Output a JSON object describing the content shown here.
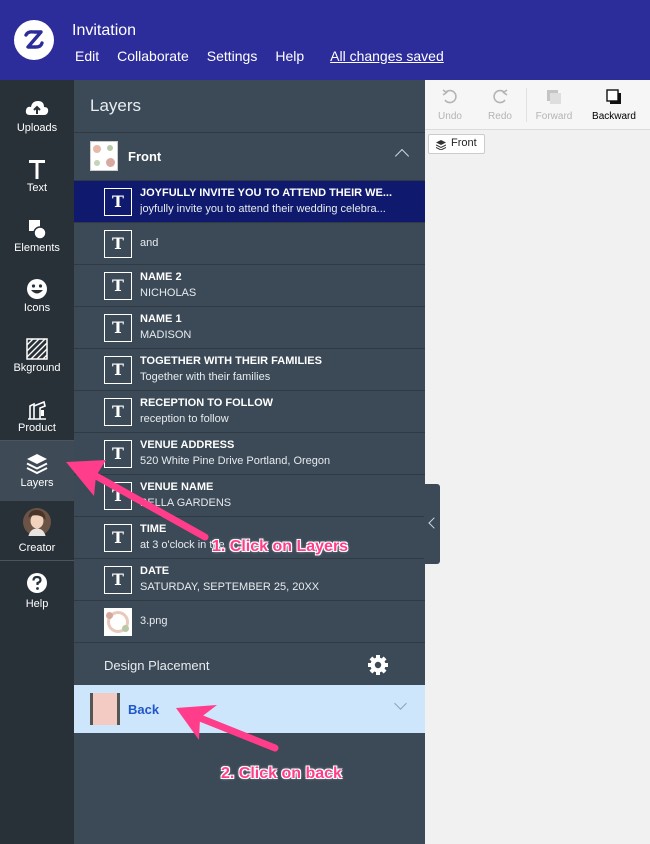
{
  "header": {
    "title": "Invitation",
    "menu": [
      "Edit",
      "Collaborate",
      "Settings",
      "Help"
    ],
    "status": "All changes saved"
  },
  "rail": {
    "items": [
      {
        "label": "Uploads",
        "icon": "cloud-upload-icon"
      },
      {
        "label": "Text",
        "icon": "text-icon"
      },
      {
        "label": "Elements",
        "icon": "elements-icon"
      },
      {
        "label": "Icons",
        "icon": "smiley-icon"
      },
      {
        "label": "Bkground",
        "icon": "background-icon"
      },
      {
        "label": "Product",
        "icon": "product-icon"
      },
      {
        "label": "Layers",
        "icon": "layers-icon",
        "active": true
      },
      {
        "label": "Creator",
        "icon": "creator-avatar"
      },
      {
        "label": "Help",
        "icon": "help-icon"
      }
    ]
  },
  "panel": {
    "title": "Layers",
    "front_group": "Front",
    "layers": [
      {
        "type": "text",
        "name": "JOYFULLY INVITE YOU TO ATTEND THEIR WE...",
        "content": "joyfully invite you to attend their wedding celebra...",
        "selected": true
      },
      {
        "type": "text",
        "name": "",
        "content": "and"
      },
      {
        "type": "text",
        "name": "NAME 2",
        "content": "NICHOLAS"
      },
      {
        "type": "text",
        "name": "NAME 1",
        "content": "MADISON"
      },
      {
        "type": "text",
        "name": "TOGETHER WITH THEIR FAMILIES",
        "content": "Together with their families"
      },
      {
        "type": "text",
        "name": "RECEPTION TO FOLLOW",
        "content": "reception to follow"
      },
      {
        "type": "text",
        "name": "VENUE ADDRESS",
        "content": "520 White Pine Drive Portland, Oregon"
      },
      {
        "type": "text",
        "name": "VENUE NAME",
        "content": "BELLA GARDENS"
      },
      {
        "type": "text",
        "name": "TIME",
        "content": "at 3 o'clock in the"
      },
      {
        "type": "text",
        "name": "DATE",
        "content": "SATURDAY, SEPTEMBER 25, 20XX"
      },
      {
        "type": "image",
        "name": "",
        "content": "3.png"
      }
    ],
    "design_placement": "Design Placement",
    "back_group": "Back"
  },
  "toolbar": {
    "undo": "Undo",
    "redo": "Redo",
    "forward": "Forward",
    "backward": "Backward"
  },
  "canvas": {
    "side_chip": "Front"
  },
  "annotations": {
    "step1": "1. Click on Layers",
    "step2": "2. Click on back",
    "color": "#ff3d8b"
  },
  "colors": {
    "header": "#2c2d9a",
    "rail": "#283038",
    "panel": "#3c4a57",
    "selected_layer": "#0f1a6e",
    "back_group": "#cde6fb"
  }
}
